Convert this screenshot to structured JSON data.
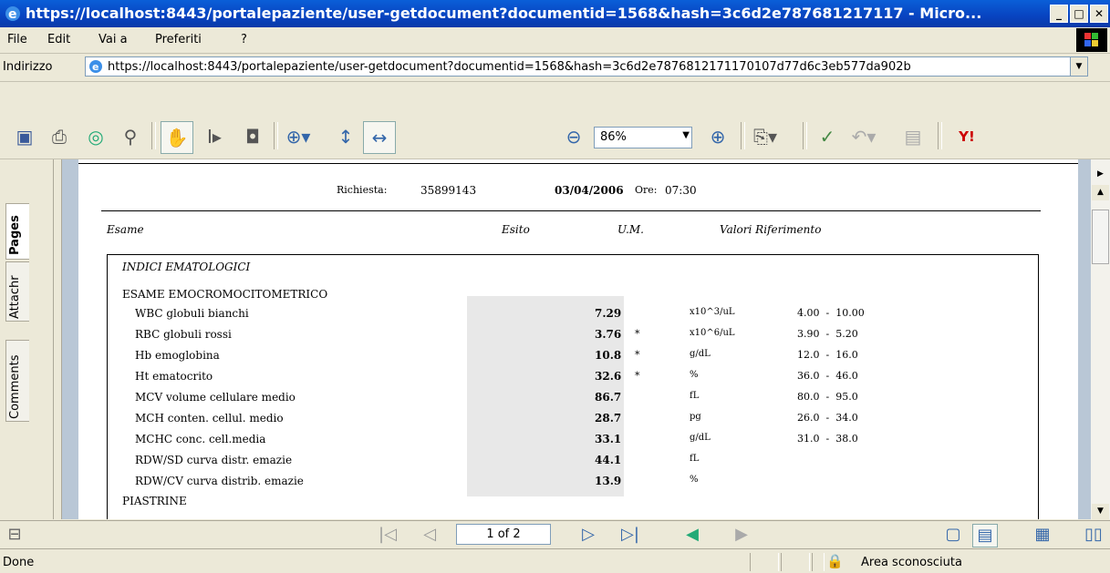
{
  "window": {
    "title": "https://localhost:8443/portalepaziente/user-getdocument?documentid=1568&hash=3c6d2e787681217117 - Micro...",
    "min": "_",
    "max": "□",
    "close": "✕"
  },
  "menu": [
    "File",
    "Edit",
    "Vai a",
    "Preferiti",
    "?"
  ],
  "address": {
    "label": "Indirizzo",
    "url": "https://localhost:8443/portalepaziente/user-getdocument?documentid=1568&hash=3c6d2e7876812171170107d77d6c3eb577da902b"
  },
  "toolbar": {
    "zoom": "86%"
  },
  "side_tabs": {
    "pages": "Pages",
    "attachments": "Attachr",
    "comments": "Comments"
  },
  "doc": {
    "richiesta_label": "Richiesta:",
    "richiesta_value": "35899143",
    "date": "03/04/2006",
    "ore_label": "Ore:",
    "ore_value": "07:30",
    "headers": {
      "esame": "Esame",
      "esito": "Esito",
      "um": "U.M.",
      "valori": "Valori Riferimento"
    },
    "section": "INDICI EMATOLOGICI",
    "group": "ESAME EMOCROMOCITOMETRICO",
    "rows": [
      {
        "name": "WBC globuli bianchi",
        "value": "7.29",
        "flag": "",
        "unit": "x10^3/uL",
        "ref": "4.00  -  10.00"
      },
      {
        "name": "RBC globuli rossi",
        "value": "3.76",
        "flag": "*",
        "unit": "x10^6/uL",
        "ref": "3.90  -  5.20"
      },
      {
        "name": "Hb emoglobina",
        "value": "10.8",
        "flag": "*",
        "unit": "g/dL",
        "ref": "12.0  -  16.0"
      },
      {
        "name": "Ht ematocrito",
        "value": "32.6",
        "flag": "*",
        "unit": "%",
        "ref": "36.0  -  46.0"
      },
      {
        "name": "MCV volume cellulare medio",
        "value": "86.7",
        "flag": "",
        "unit": "fL",
        "ref": "80.0  -  95.0"
      },
      {
        "name": "MCH conten. cellul. medio",
        "value": "28.7",
        "flag": "",
        "unit": "pg",
        "ref": "26.0  -  34.0"
      },
      {
        "name": "MCHC  conc. cell.media",
        "value": "33.1",
        "flag": "",
        "unit": "g/dL",
        "ref": "31.0  -  38.0"
      },
      {
        "name": "RDW/SD curva distr. emazie",
        "value": "44.1",
        "flag": "",
        "unit": "fL",
        "ref": ""
      },
      {
        "name": "RDW/CV curva distrib. emazie",
        "value": "13.9",
        "flag": "",
        "unit": "%",
        "ref": ""
      }
    ],
    "next_group": "PIASTRINE"
  },
  "nav": {
    "page": "1 of 2"
  },
  "status": {
    "text": "Done",
    "zone": "Area sconosciuta"
  }
}
